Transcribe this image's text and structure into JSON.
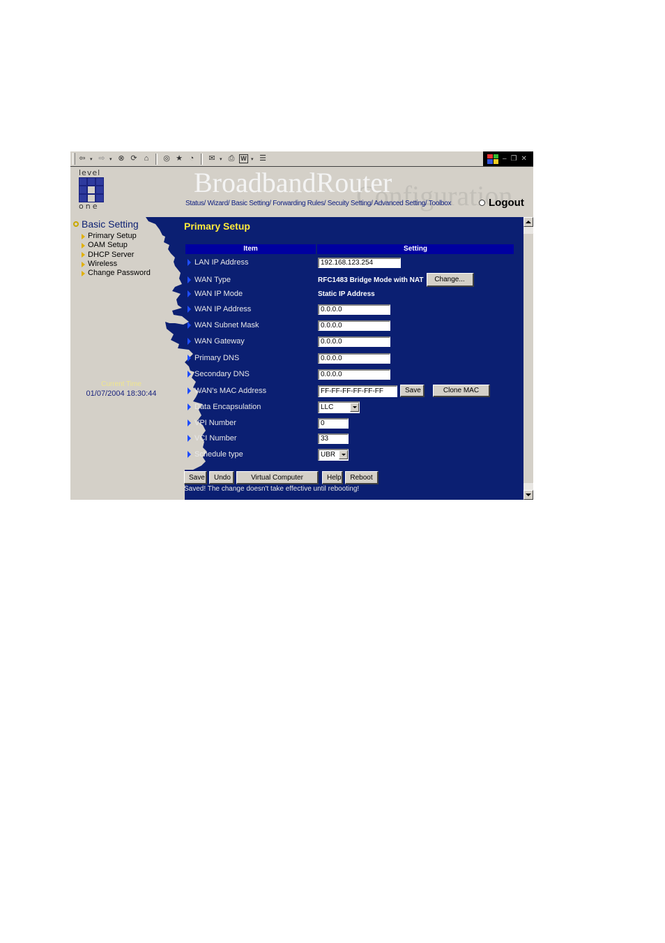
{
  "toolbar": {
    "icons": [
      "back-icon",
      "forward-icon",
      "stop-icon",
      "refresh-icon",
      "home-icon",
      "search-icon",
      "favorites-icon",
      "history-icon",
      "mail-icon",
      "print-icon",
      "edit-icon",
      "discuss-icon"
    ],
    "glyphs": {
      "back": "⇦",
      "forward": "⇨",
      "stop": "⊗",
      "refresh": "⟳",
      "home": "⌂",
      "search": "🔍",
      "favorites": "★",
      "history": "◔",
      "mail": "✉",
      "print": "⎙",
      "edit": "W",
      "discuss": "☰"
    },
    "window_controls": {
      "minimize": "–",
      "restore": "❐",
      "close": "✕"
    }
  },
  "header": {
    "logo_top": "level",
    "logo_bottom": "one",
    "brand": "BroadbandRouter",
    "brand_sub": "Configuration",
    "nav": [
      {
        "label": "Status/"
      },
      {
        "label": "Wizard/"
      },
      {
        "label": "Basic Setting/"
      },
      {
        "label": "Forwarding Rules/"
      },
      {
        "label": "Secuity Setting/"
      },
      {
        "label": "Advanced Setting/"
      },
      {
        "label": "Toolbox"
      }
    ],
    "logout": "Logout"
  },
  "sidebar": {
    "title": "Basic Setting",
    "items": [
      {
        "label": "Primary Setup"
      },
      {
        "label": "OAM Setup"
      },
      {
        "label": "DHCP Server"
      },
      {
        "label": "Wireless"
      },
      {
        "label": "Change Password"
      }
    ],
    "current_time_label": "Current Time",
    "current_time_value": "01/07/2004 18:30:44"
  },
  "main": {
    "title": "Primary Setup",
    "columns": [
      "Item",
      "Setting"
    ],
    "rows": {
      "lan_ip": {
        "label": "LAN IP Address",
        "value": "192.168.123.254"
      },
      "wan_type": {
        "label": "WAN Type",
        "value": "RFC1483 Bridge Mode with NAT",
        "button": "Change..."
      },
      "wan_ip_mode": {
        "label": "WAN IP Mode",
        "value": "Static IP Address"
      },
      "wan_ip": {
        "label": "WAN IP Address",
        "value": "0.0.0.0"
      },
      "wan_mask": {
        "label": "WAN Subnet Mask",
        "value": "0.0.0.0"
      },
      "wan_gw": {
        "label": "WAN Gateway",
        "value": "0.0.0.0"
      },
      "dns1": {
        "label": "Primary DNS",
        "value": "0.0.0.0"
      },
      "dns2": {
        "label": "Secondary DNS",
        "value": "0.0.0.0"
      },
      "mac": {
        "label": "WAN's MAC Address",
        "value": "FF-FF-FF-FF-FF-FF",
        "save": "Save",
        "clone": "Clone MAC"
      },
      "encap": {
        "label": "Data Encapsulation",
        "value": "LLC"
      },
      "vpi": {
        "label": "VPI Number",
        "value": "0"
      },
      "vci": {
        "label": "VCI Number",
        "value": "33"
      },
      "sched": {
        "label": "Schedule type",
        "value": "UBR"
      }
    },
    "actions": [
      "Save",
      "Undo",
      "Virtual Computer",
      "Help",
      "Reboot"
    ],
    "message": "Saved! The change doesn't take effective until rebooting!"
  },
  "colors": {
    "frame_bg": "#0b1f72",
    "header_bar": "#0000a0",
    "title_yellow": "#ffeb3b",
    "panel_gray": "#d4d0c8"
  }
}
